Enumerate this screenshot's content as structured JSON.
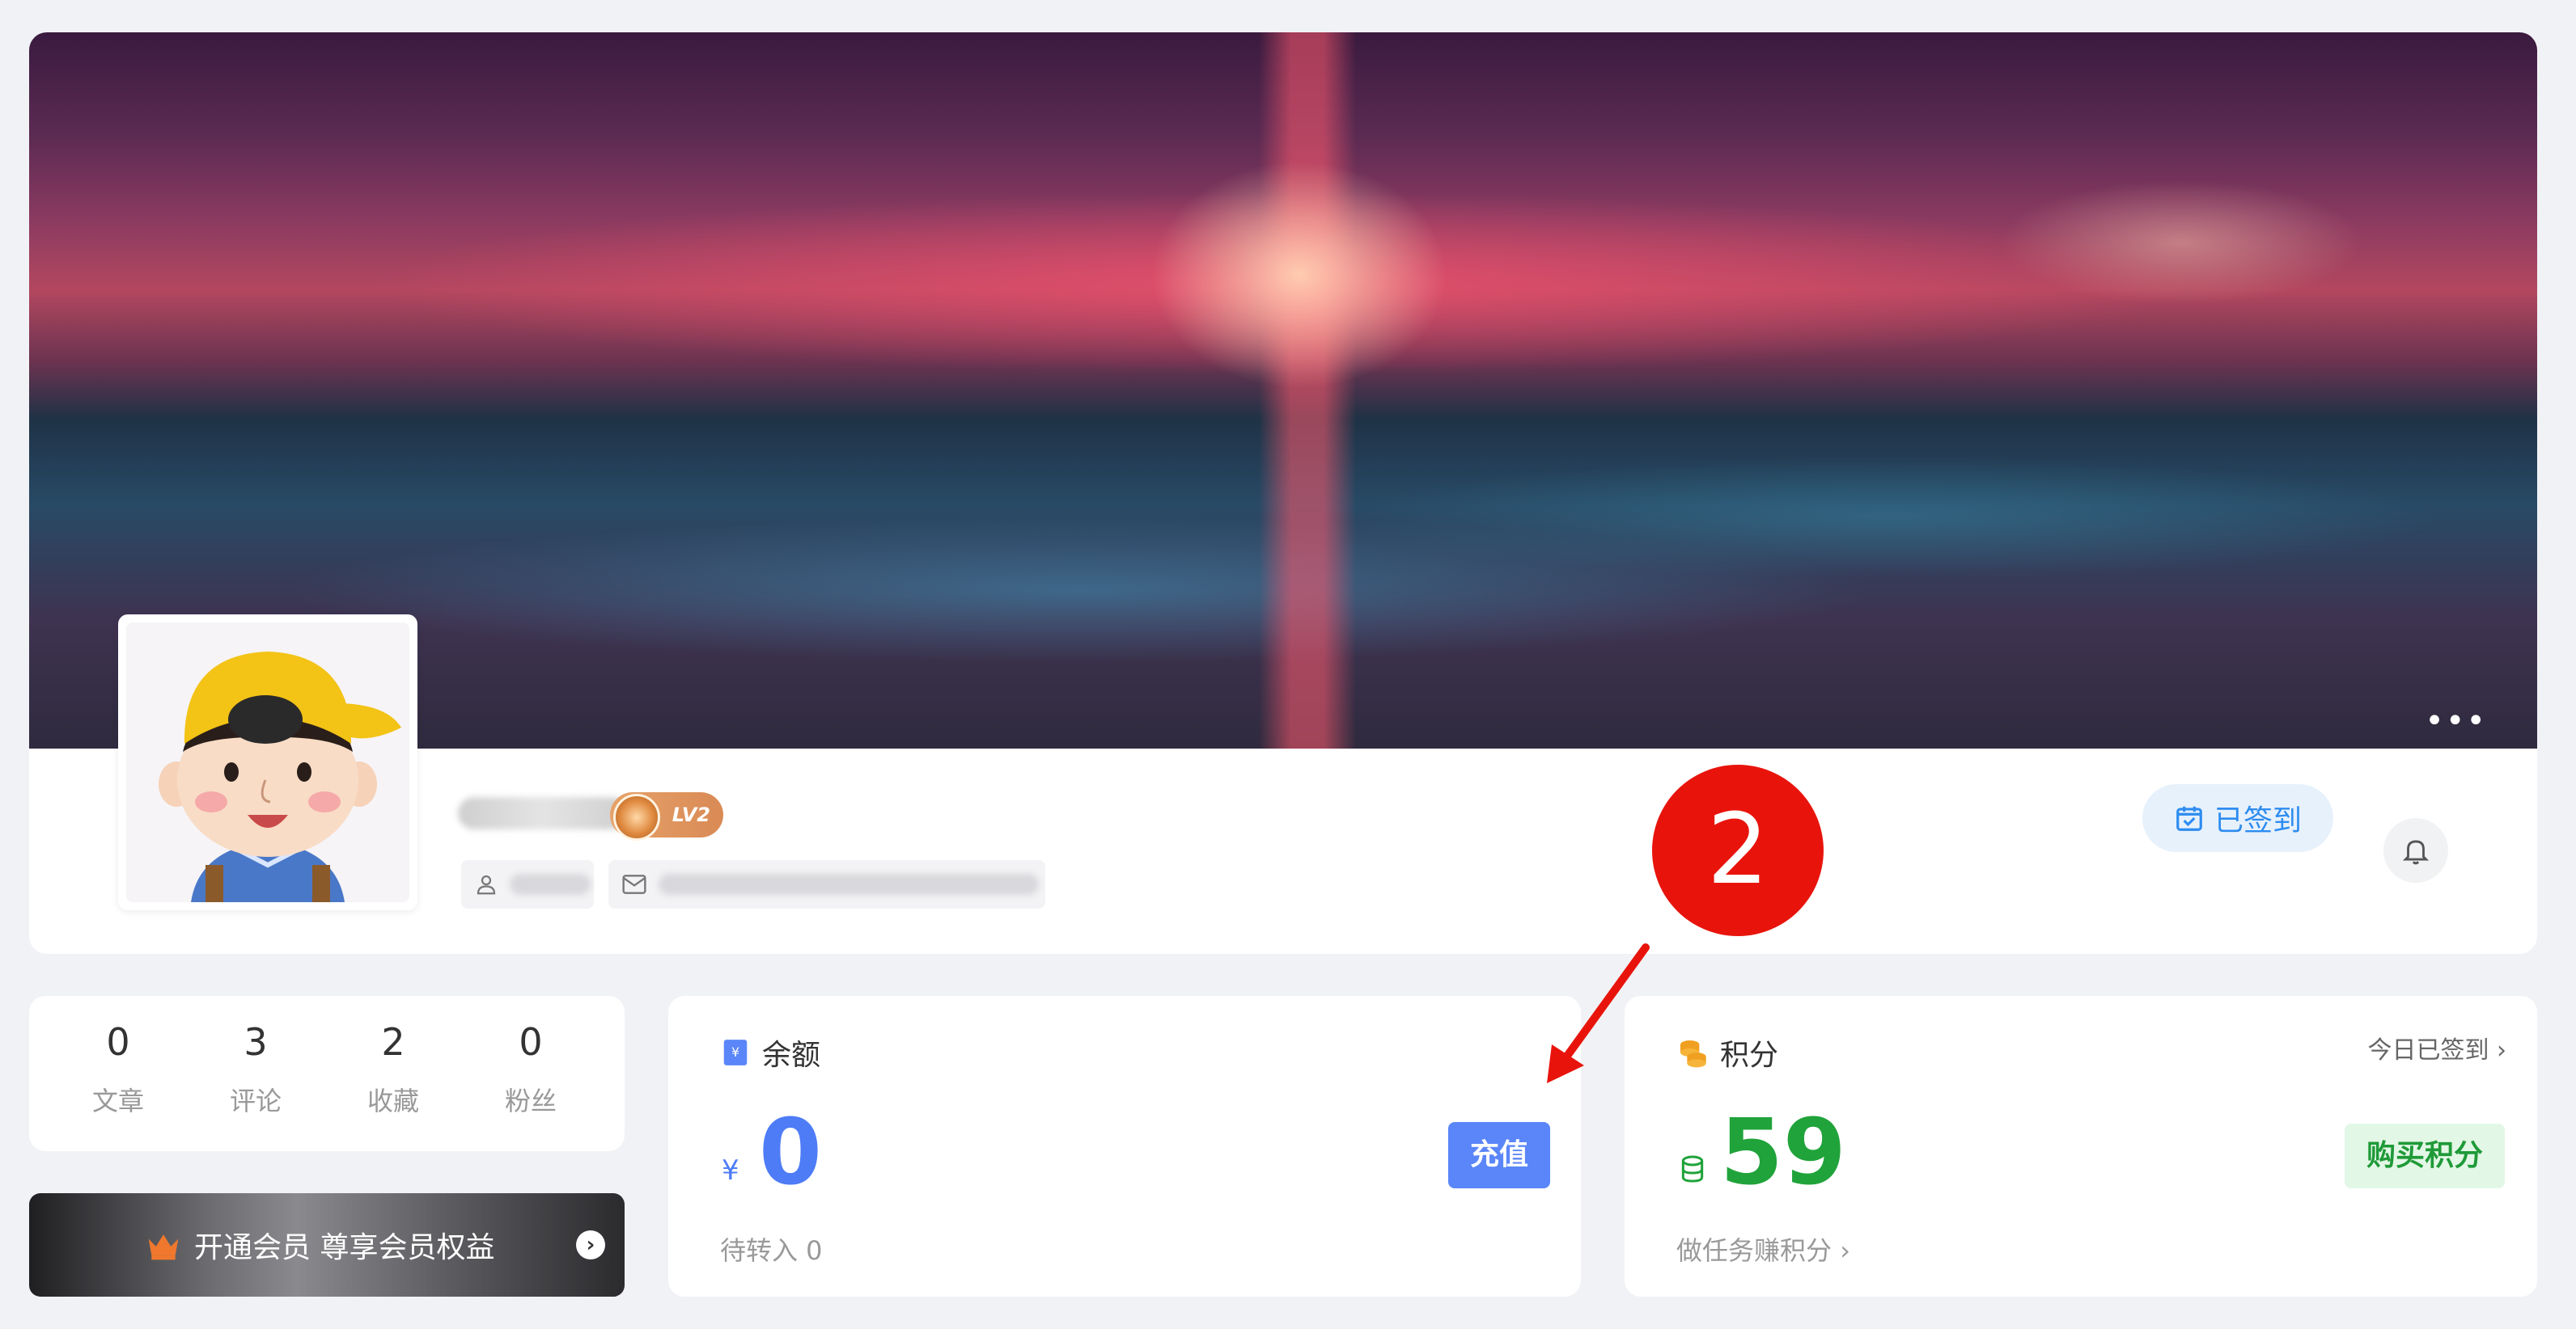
{
  "profile": {
    "more_icon_text": "•••",
    "level": "LV2",
    "checkin_label": "已签到"
  },
  "annotation": {
    "step": "2"
  },
  "stats": [
    {
      "num": "0",
      "label": "文章"
    },
    {
      "num": "3",
      "label": "评论"
    },
    {
      "num": "2",
      "label": "收藏"
    },
    {
      "num": "0",
      "label": "粉丝"
    }
  ],
  "vip": {
    "text": "开通会员 尊享会员权益",
    "go_icon": "›"
  },
  "balance": {
    "title": "余额",
    "currency": "¥",
    "amount": "0",
    "recharge_label": "充值",
    "pending": "待转入 0"
  },
  "points": {
    "title": "积分",
    "today_link": "今日已签到",
    "amount": "59",
    "buy_label": "购买积分",
    "task_link": "做任务赚积分"
  },
  "colors": {
    "accent_blue": "#4e7cf7",
    "accent_green": "#20a33a",
    "annotation_red": "#e8140c"
  }
}
